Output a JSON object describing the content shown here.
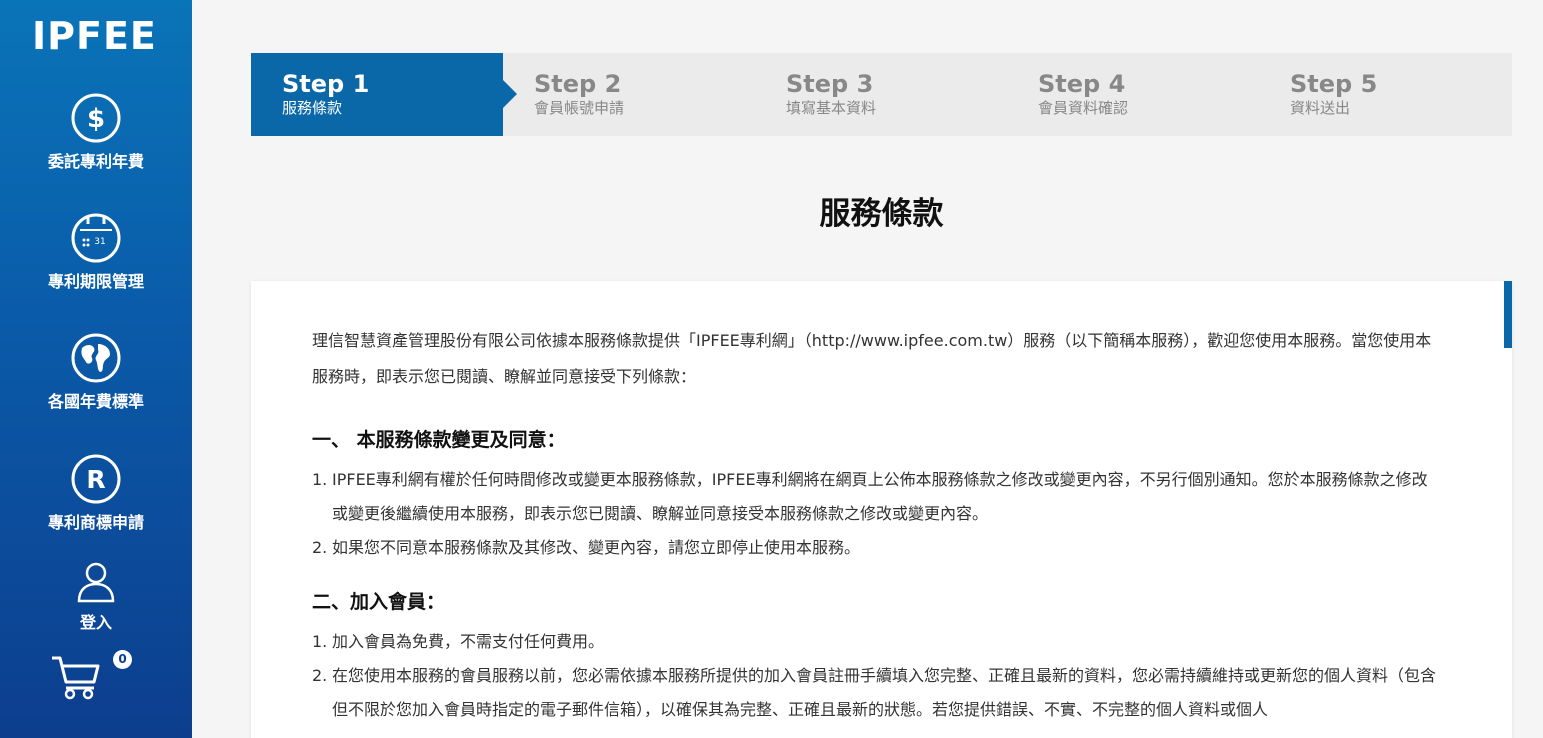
{
  "brand": {
    "logo": "IPFEE"
  },
  "sidebar": {
    "items": [
      {
        "label": "委託專利年費",
        "icon": "dollar-circle-icon"
      },
      {
        "label": "專利期限管理",
        "icon": "calendar-clock-icon"
      },
      {
        "label": "各國年費標準",
        "icon": "globe-icon"
      },
      {
        "label": "專利商標申請",
        "icon": "registered-mark-icon"
      },
      {
        "label": "登入",
        "icon": "user-icon"
      }
    ],
    "cart": {
      "icon": "cart-icon",
      "count": "0"
    }
  },
  "steps": [
    {
      "num": "Step 1",
      "name": "服務條款",
      "active": true
    },
    {
      "num": "Step 2",
      "name": "會員帳號申請",
      "active": false
    },
    {
      "num": "Step 3",
      "name": "填寫基本資料",
      "active": false
    },
    {
      "num": "Step 4",
      "name": "會員資料確認",
      "active": false
    },
    {
      "num": "Step 5",
      "name": "資料送出",
      "active": false
    }
  ],
  "page": {
    "title": "服務條款"
  },
  "terms": {
    "intro": "理信智慧資產管理股份有限公司依據本服務條款提供「IPFEE專利網」（http://www.ipfee.com.tw）服務（以下簡稱本服務），歡迎您使用本服務。當您使用本服務時，即表示您已閱讀、瞭解並同意接受下列條款：",
    "sections": [
      {
        "heading": "一、 本服務條款變更及同意：",
        "items": [
          "IPFEE專利網有權於任何時間修改或變更本服務條款，IPFEE專利網將在網頁上公佈本服務條款之修改或變更內容，不另行個別通知。您於本服務條款之修改或變更後繼續使用本服務，即表示您已閱讀、瞭解並同意接受本服務條款之修改或變更內容。",
          "如果您不同意本服務條款及其修改、變更內容，請您立即停止使用本服務。"
        ]
      },
      {
        "heading": "二、加入會員：",
        "items": [
          "加入會員為免費，不需支付任何費用。",
          "在您使用本服務的會員服務以前，您必需依據本服務所提供的加入會員註冊手續填入您完整、正確且最新的資料，您必需持續維持或更新您的個人資料（包含但不限於您加入會員時指定的電子郵件信箱），以確保其為完整、正確且最新的狀態。若您提供錯誤、不實、不完整的個人資料或個人"
        ]
      }
    ]
  },
  "colors": {
    "primary": "#0a68a8",
    "sidebar_top": "#0a74b8",
    "sidebar_bottom": "#0d3e8e",
    "step_bg": "#ebebeb"
  }
}
